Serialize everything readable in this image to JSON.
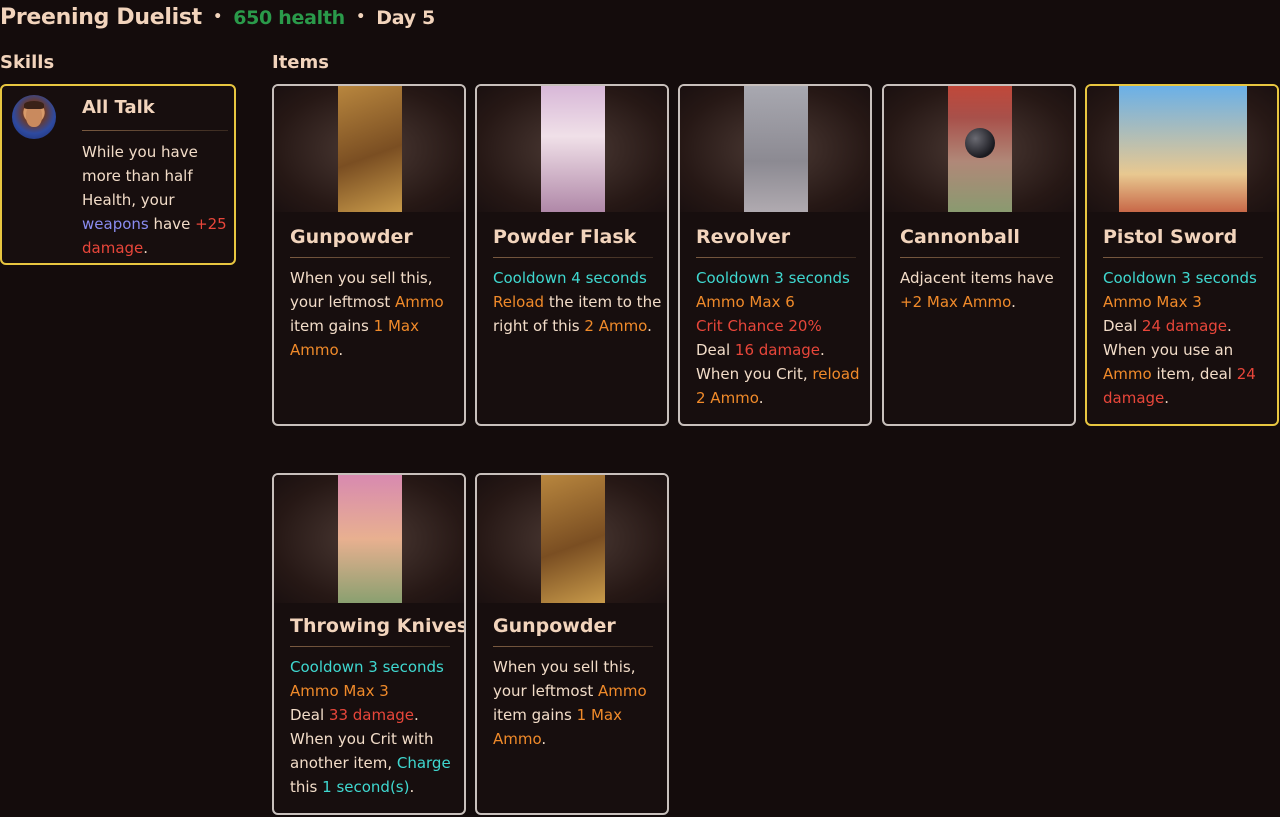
{
  "header": {
    "title": "Preening Duelist",
    "separator": "•",
    "health": "650 health",
    "day": "Day 5"
  },
  "sections": {
    "skills": "Skills",
    "items": "Items"
  },
  "colors": {
    "cooldown": "#3fd8d0",
    "ammo": "#f08a2a",
    "damage": "#e8463a",
    "keyword": "#8a8cf0",
    "highlight_border": "#e8c640",
    "health": "#2a9a4a"
  },
  "skill": {
    "name": "All Talk",
    "icon": "duelist-portrait-icon",
    "desc": [
      "While you have",
      "more than half",
      "Health, your",
      "weapons",
      " have ",
      "+25",
      "damage",
      "."
    ]
  },
  "items": [
    {
      "name": "Gunpowder",
      "icon": "gunpowder-icon",
      "lines": [
        [
          "When you sell this,"
        ],
        [
          "your leftmost ",
          "Ammo"
        ],
        [
          "item gains ",
          "1 Max"
        ],
        [
          "Ammo",
          "."
        ]
      ]
    },
    {
      "name": "Powder Flask",
      "icon": "powder-flask-icon",
      "lines": [
        [
          "Cooldown ",
          "4",
          " seconds"
        ],
        [
          "Reload",
          " the item to the"
        ],
        [
          "right of this ",
          "2 Ammo",
          "."
        ]
      ]
    },
    {
      "name": "Revolver",
      "icon": "revolver-icon",
      "lines": [
        [
          "Cooldown ",
          "3",
          " seconds"
        ],
        [
          "Ammo Max ",
          "6"
        ],
        [
          "Crit Chance ",
          "20%"
        ],
        [
          "Deal ",
          "16 damage",
          "."
        ],
        [
          "When you Crit, ",
          "reload"
        ],
        [
          "2 Ammo",
          "."
        ]
      ]
    },
    {
      "name": "Cannonball",
      "icon": "cannonball-icon",
      "lines": [
        [
          "Adjacent items have"
        ],
        [
          "+2 Max Ammo",
          "."
        ]
      ]
    },
    {
      "name": "Pistol Sword",
      "icon": "pistol-sword-icon",
      "lines": [
        [
          "Cooldown ",
          "3",
          " seconds"
        ],
        [
          "Ammo Max ",
          "3"
        ],
        [
          "Deal ",
          "24 damage",
          "."
        ],
        [
          "When you use an"
        ],
        [
          "Ammo",
          " item, deal ",
          "24"
        ],
        [
          "damage",
          "."
        ]
      ]
    },
    {
      "name": "Throwing Knives",
      "icon": "throwing-knives-icon",
      "lines": [
        [
          "Cooldown ",
          "3",
          " seconds"
        ],
        [
          "Ammo Max ",
          "3"
        ],
        [
          "Deal ",
          "33 damage",
          "."
        ],
        [
          "When you Crit with"
        ],
        [
          "another item, ",
          "Charge"
        ],
        [
          "this ",
          "1 second(s)",
          "."
        ]
      ]
    },
    {
      "name": "Gunpowder",
      "icon": "gunpowder-icon",
      "lines": [
        [
          "When you sell this,"
        ],
        [
          "your leftmost ",
          "Ammo"
        ],
        [
          "item gains ",
          "1 Max"
        ],
        [
          "Ammo",
          "."
        ]
      ]
    }
  ]
}
